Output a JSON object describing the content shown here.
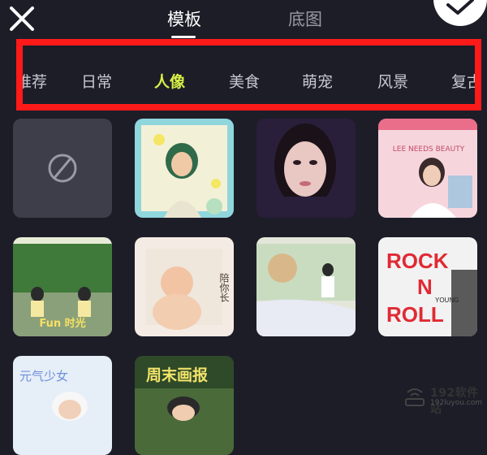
{
  "tabs": [
    {
      "label": "模板",
      "active": true
    },
    {
      "label": "底图",
      "active": false
    }
  ],
  "categories": [
    {
      "label": "推荐",
      "active": false
    },
    {
      "label": "日常",
      "active": false
    },
    {
      "label": "人像",
      "active": true
    },
    {
      "label": "美食",
      "active": false
    },
    {
      "label": "萌宠",
      "active": false
    },
    {
      "label": "风景",
      "active": false
    },
    {
      "label": "复古",
      "active": false
    }
  ],
  "templates": [
    {
      "kind": "none",
      "icon": "no-template-icon"
    },
    {
      "kind": "thumb",
      "label": ""
    },
    {
      "kind": "thumb",
      "label": ""
    },
    {
      "kind": "thumb",
      "text": "LEE NEEDS BEAUTY"
    },
    {
      "kind": "thumb",
      "text": "Fun 时光"
    },
    {
      "kind": "thumb",
      "text": "陪你长"
    },
    {
      "kind": "thumb",
      "text": ""
    },
    {
      "kind": "thumb",
      "text": "ROCK N ROLL",
      "sub": "YOUNG"
    },
    {
      "kind": "thumb",
      "text": "元气少女"
    },
    {
      "kind": "thumb",
      "text": "周末画报"
    }
  ],
  "watermark": {
    "title": "192软件站",
    "subtitle": "192luyou.com"
  },
  "colors": {
    "background": "#1d1d28",
    "accent": "#d8f046",
    "highlight": "#ff1a1a"
  }
}
